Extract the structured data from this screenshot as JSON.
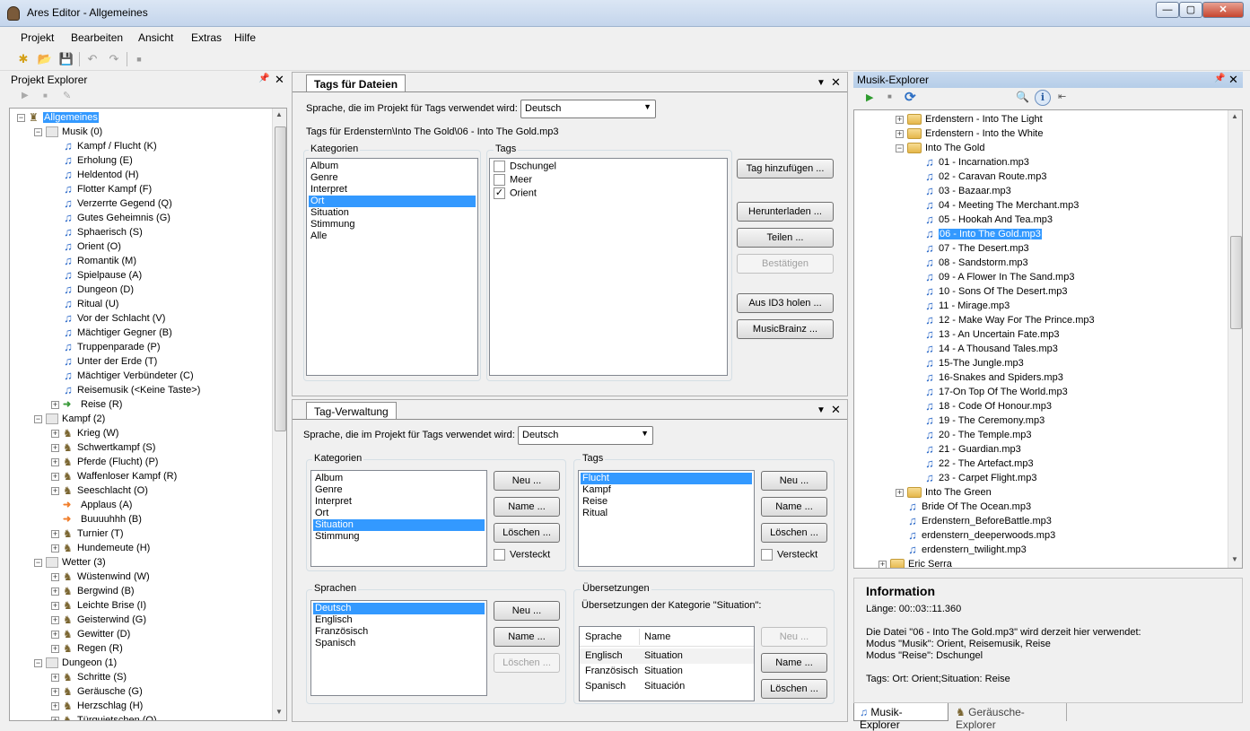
{
  "window": {
    "title": "Ares Editor - Allgemeines",
    "min": "—",
    "max": "▢",
    "close": "✕"
  },
  "menu": [
    "Projekt",
    "Bearbeiten",
    "Ansicht",
    "Extras",
    "Hilfe"
  ],
  "toolbar": {
    "new_icon": "✱",
    "open_icon": "📂",
    "save_icon": "💾",
    "undo_icon": "↶",
    "redo_icon": "↷",
    "stop_icon": "■"
  },
  "project_explorer": {
    "title": "Projekt Explorer",
    "pin": "📌",
    "close": "✕",
    "play": "▶",
    "stop": "■",
    "tool": "✎",
    "rows": [
      {
        "d": 0,
        "exp": "-",
        "ic": "root",
        "t": "Allgemeines",
        "sel": true
      },
      {
        "d": 1,
        "exp": "-",
        "ic": "cat",
        "t": "Musik (0)"
      },
      {
        "d": 2,
        "ic": "note",
        "t": "Kampf / Flucht (K)"
      },
      {
        "d": 2,
        "ic": "note",
        "t": "Erholung (E)"
      },
      {
        "d": 2,
        "ic": "note",
        "t": "Heldentod (H)"
      },
      {
        "d": 2,
        "ic": "note",
        "t": "Flotter Kampf (F)"
      },
      {
        "d": 2,
        "ic": "note",
        "t": "Verzerrte Gegend (Q)"
      },
      {
        "d": 2,
        "ic": "note",
        "t": "Gutes Geheimnis (G)"
      },
      {
        "d": 2,
        "ic": "note",
        "t": "Sphaerisch (S)"
      },
      {
        "d": 2,
        "ic": "note",
        "t": "Orient (O)"
      },
      {
        "d": 2,
        "ic": "note",
        "t": "Romantik (M)"
      },
      {
        "d": 2,
        "ic": "note",
        "t": "Spielpause (A)"
      },
      {
        "d": 2,
        "ic": "note",
        "t": "Dungeon (D)"
      },
      {
        "d": 2,
        "ic": "note",
        "t": "Ritual (U)"
      },
      {
        "d": 2,
        "ic": "note",
        "t": "Vor der Schlacht (V)"
      },
      {
        "d": 2,
        "ic": "note",
        "t": "Mächtiger Gegner (B)"
      },
      {
        "d": 2,
        "ic": "note",
        "t": "Truppenparade (P)"
      },
      {
        "d": 2,
        "ic": "note",
        "t": "Unter der Erde (T)"
      },
      {
        "d": 2,
        "ic": "note",
        "t": "Mächtiger Verbündeter (C)"
      },
      {
        "d": 2,
        "ic": "note",
        "t": "Reisemusik (<Keine Taste>)"
      },
      {
        "d": 2,
        "exp": "+",
        "ic": "arrowg",
        "t": "Reise (R)"
      },
      {
        "d": 1,
        "exp": "-",
        "ic": "cat",
        "t": "Kampf (2)"
      },
      {
        "d": 2,
        "exp": "+",
        "ic": "horse",
        "t": "Krieg (W)"
      },
      {
        "d": 2,
        "exp": "+",
        "ic": "horse",
        "t": "Schwertkampf (S)"
      },
      {
        "d": 2,
        "exp": "+",
        "ic": "horse",
        "t": "Pferde (Flucht) (P)"
      },
      {
        "d": 2,
        "exp": "+",
        "ic": "horse",
        "t": "Waffenloser Kampf (R)"
      },
      {
        "d": 2,
        "exp": "+",
        "ic": "horse",
        "t": "Seeschlacht (O)"
      },
      {
        "d": 2,
        "ic": "arrow",
        "t": "Applaus (A)"
      },
      {
        "d": 2,
        "ic": "arrow",
        "t": "Buuuuhhh (B)"
      },
      {
        "d": 2,
        "exp": "+",
        "ic": "horse",
        "t": "Turnier (T)"
      },
      {
        "d": 2,
        "exp": "+",
        "ic": "horse",
        "t": "Hundemeute (H)"
      },
      {
        "d": 1,
        "exp": "-",
        "ic": "cat",
        "t": "Wetter (3)"
      },
      {
        "d": 2,
        "exp": "+",
        "ic": "horse",
        "t": "Wüstenwind (W)"
      },
      {
        "d": 2,
        "exp": "+",
        "ic": "horse",
        "t": "Bergwind (B)"
      },
      {
        "d": 2,
        "exp": "+",
        "ic": "horse",
        "t": "Leichte Brise (I)"
      },
      {
        "d": 2,
        "exp": "+",
        "ic": "horse",
        "t": "Geisterwind (G)"
      },
      {
        "d": 2,
        "exp": "+",
        "ic": "horse",
        "t": "Gewitter (D)"
      },
      {
        "d": 2,
        "exp": "+",
        "ic": "horse",
        "t": "Regen (R)"
      },
      {
        "d": 1,
        "exp": "-",
        "ic": "cat",
        "t": "Dungeon (1)"
      },
      {
        "d": 2,
        "exp": "+",
        "ic": "horse",
        "t": "Schritte (S)"
      },
      {
        "d": 2,
        "exp": "+",
        "ic": "horse",
        "t": "Geräusche (G)"
      },
      {
        "d": 2,
        "exp": "+",
        "ic": "horse",
        "t": "Herzschlag (H)"
      },
      {
        "d": 2,
        "exp": "+",
        "ic": "horse",
        "t": "Türquietschen (Q)"
      }
    ]
  },
  "tags_files": {
    "tab": "Tags für Dateien",
    "lang_label": "Sprache, die im Projekt für Tags verwendet wird:",
    "lang": "Deutsch",
    "file_label": "Tags für Erdenstern\\Into The Gold\\06 - Into The Gold.mp3",
    "cat_label": "Kategorien",
    "tags_label": "Tags",
    "categories": [
      "Album",
      "Genre",
      "Interpret",
      "Ort",
      "Situation",
      "Stimmung",
      "Alle"
    ],
    "cat_selected": 3,
    "tags": [
      {
        "t": "Dschungel",
        "c": false
      },
      {
        "t": "Meer",
        "c": false
      },
      {
        "t": "Orient",
        "c": true
      }
    ],
    "buttons": [
      "Tag hinzufügen ...",
      "Herunterladen ...",
      "Teilen ...",
      "Bestätigen",
      "Aus ID3 holen ...",
      "MusicBrainz ..."
    ]
  },
  "tag_admin": {
    "tab": "Tag-Verwaltung",
    "lang_label": "Sprache, die im Projekt für Tags verwendet wird:",
    "lang": "Deutsch",
    "cat_label": "Kategorien",
    "categories": [
      "Album",
      "Genre",
      "Interpret",
      "Ort",
      "Situation",
      "Stimmung"
    ],
    "cat_selected": 4,
    "tags_label": "Tags",
    "tags": [
      "Flucht",
      "Kampf",
      "Reise",
      "Ritual"
    ],
    "tag_selected": 0,
    "new": "Neu ...",
    "rename": "Name ...",
    "delete": "Löschen ...",
    "hidden": "Versteckt",
    "lang_group": "Sprachen",
    "languages": [
      "Deutsch",
      "Englisch",
      "Französisch",
      "Spanisch"
    ],
    "lang_selected": 0,
    "trans_group": "Übersetzungen",
    "trans_label": "Übersetzungen der Kategorie \"Situation\":",
    "trans_cols": [
      "Sprache",
      "Name"
    ],
    "trans_rows": [
      [
        "Englisch",
        "Situation"
      ],
      [
        "Französisch",
        "Situation"
      ],
      [
        "Spanisch",
        "Situación"
      ]
    ]
  },
  "music_explorer": {
    "title": "Musik-Explorer",
    "play": "▶",
    "stop": "■",
    "refresh": "⟳",
    "search": "🔍",
    "info": "i",
    "collapse": "⇤",
    "rows": [
      {
        "d": 1,
        "exp": "+",
        "ic": "folder",
        "t": "Erdenstern - Into The Light"
      },
      {
        "d": 1,
        "exp": "+",
        "ic": "folder",
        "t": "Erdenstern - Into the White"
      },
      {
        "d": 1,
        "exp": "-",
        "ic": "folder",
        "t": "Into The Gold"
      },
      {
        "d": 2,
        "ic": "note",
        "t": "01 - Incarnation.mp3"
      },
      {
        "d": 2,
        "ic": "note",
        "t": "02 - Caravan Route.mp3"
      },
      {
        "d": 2,
        "ic": "note",
        "t": "03 - Bazaar.mp3"
      },
      {
        "d": 2,
        "ic": "note",
        "t": "04 - Meeting The Merchant.mp3"
      },
      {
        "d": 2,
        "ic": "note",
        "t": "05 - Hookah And Tea.mp3"
      },
      {
        "d": 2,
        "ic": "note",
        "t": "06 - Into The Gold.mp3",
        "sel": true
      },
      {
        "d": 2,
        "ic": "note",
        "t": "07 - The Desert.mp3"
      },
      {
        "d": 2,
        "ic": "note",
        "t": "08 - Sandstorm.mp3"
      },
      {
        "d": 2,
        "ic": "note",
        "t": "09 - A Flower In The Sand.mp3"
      },
      {
        "d": 2,
        "ic": "note",
        "t": "10 - Sons Of The Desert.mp3"
      },
      {
        "d": 2,
        "ic": "note",
        "t": "11 - Mirage.mp3"
      },
      {
        "d": 2,
        "ic": "note",
        "t": "12 - Make Way For The Prince.mp3"
      },
      {
        "d": 2,
        "ic": "note",
        "t": "13 - An Uncertain Fate.mp3"
      },
      {
        "d": 2,
        "ic": "note",
        "t": "14 - A Thousand Tales.mp3"
      },
      {
        "d": 2,
        "ic": "note",
        "t": "15-The Jungle.mp3"
      },
      {
        "d": 2,
        "ic": "note",
        "t": "16-Snakes and Spiders.mp3"
      },
      {
        "d": 2,
        "ic": "note",
        "t": "17-On Top Of The World.mp3"
      },
      {
        "d": 2,
        "ic": "note",
        "t": "18 - Code Of Honour.mp3"
      },
      {
        "d": 2,
        "ic": "note",
        "t": "19 - The Ceremony.mp3"
      },
      {
        "d": 2,
        "ic": "note",
        "t": "20 - The Temple.mp3"
      },
      {
        "d": 2,
        "ic": "note",
        "t": "21 - Guardian.mp3"
      },
      {
        "d": 2,
        "ic": "note",
        "t": "22 - The Artefact.mp3"
      },
      {
        "d": 2,
        "ic": "note",
        "t": "23 - Carpet Flight.mp3"
      },
      {
        "d": 1,
        "exp": "+",
        "ic": "folder",
        "t": "Into The Green"
      },
      {
        "d": 1,
        "ic": "note",
        "t": "Bride Of The Ocean.mp3"
      },
      {
        "d": 1,
        "ic": "note",
        "t": "Erdenstern_BeforeBattle.mp3"
      },
      {
        "d": 1,
        "ic": "note",
        "t": "erdenstern_deeperwoods.mp3"
      },
      {
        "d": 1,
        "ic": "note",
        "t": "erdenstern_twilight.mp3"
      },
      {
        "d": 0,
        "exp": "+",
        "ic": "folder",
        "t": "Eric Serra"
      }
    ]
  },
  "information": {
    "title": "Information",
    "lines": [
      "Länge: 00::03::11.360",
      "",
      "Die Datei \"06 - Into The Gold.mp3\" wird derzeit hier verwendet:",
      "Modus \"Musik\": Orient, Reisemusik, Reise",
      "Modus \"Reise\": Dschungel",
      "",
      "Tags: Ort: Orient;Situation: Reise"
    ]
  },
  "bottom_tabs": [
    "Musik-Explorer",
    "Geräusche-Explorer"
  ]
}
